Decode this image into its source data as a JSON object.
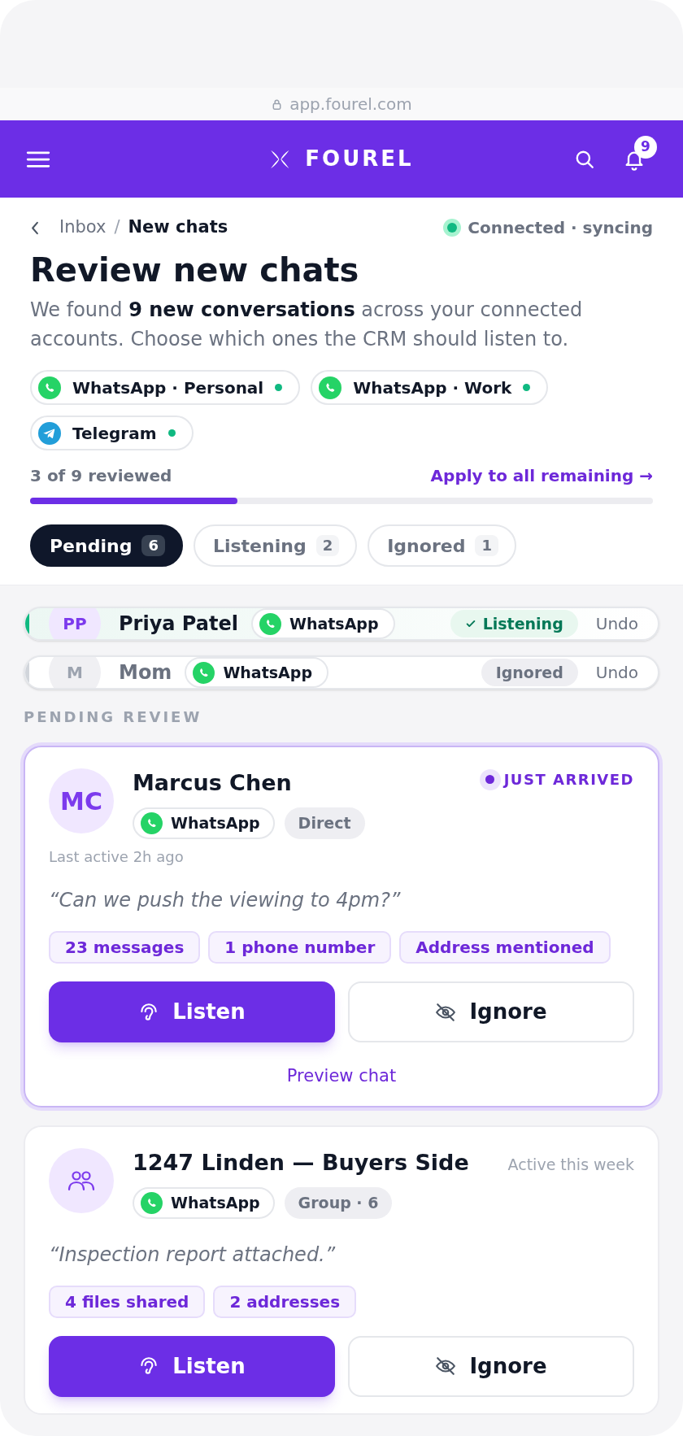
{
  "browser": {
    "url": "app.fourel.com"
  },
  "header": {
    "brand": "FOUREL",
    "notifications": "9"
  },
  "breadcrumb": {
    "parent": "Inbox",
    "separator": "/",
    "current": "New chats"
  },
  "connection": {
    "text": "Connected · syncing",
    "connected": true
  },
  "title": "Review new chats",
  "description": "We found **9 new conversations** across your connected accounts. Choose which ones the CRM should listen to.",
  "accounts": [
    {
      "kind": "whatsapp",
      "label": "WhatsApp · Personal",
      "online": true
    },
    {
      "kind": "whatsapp",
      "label": "WhatsApp · Work",
      "online": true
    },
    {
      "kind": "telegram",
      "label": "Telegram",
      "online": true
    }
  ],
  "progress": {
    "text": "3 of 9 reviewed",
    "level": 0.333,
    "action": "Apply to all remaining →"
  },
  "tabs": [
    {
      "label": "Pending",
      "count": "6",
      "selected": true
    },
    {
      "label": "Listening",
      "count": "2",
      "selected": false
    },
    {
      "label": "Ignored",
      "count": "1",
      "selected": false
    }
  ],
  "reviewed": [
    {
      "initials": "PP",
      "name": "Priya Patel",
      "channel": "WhatsApp",
      "kind": "listening",
      "status": "Listening",
      "undo": "Undo"
    },
    {
      "initials": "M",
      "name": "Mom",
      "channel": "WhatsApp",
      "kind": "ignored",
      "status": "Ignored",
      "undo": "Undo"
    }
  ],
  "section_label": "PENDING REVIEW",
  "cards": [
    {
      "avatar": {
        "kind": "initials",
        "text": "MC"
      },
      "name": "Marcus Chen",
      "badge": "JUST ARRIVED",
      "highlighted": true,
      "channel": "WhatsApp",
      "type": "Direct",
      "last_active": "Last active 2h ago",
      "quote": "“Can we push the viewing to 4pm?”",
      "tags": [
        "23 messages",
        "1 phone number",
        "Address mentioned"
      ],
      "listen": "Listen",
      "ignore": "Ignore",
      "preview": "Preview chat"
    },
    {
      "avatar": {
        "kind": "group"
      },
      "name": "1247 Linden — Buyers Side",
      "activity": "Active this week",
      "highlighted": false,
      "channel": "WhatsApp",
      "type": "Group · 6",
      "quote": "“Inspection report attached.”",
      "tags": [
        "4 files shared",
        "2 addresses"
      ],
      "listen": "Listen",
      "ignore": "Ignore"
    }
  ]
}
